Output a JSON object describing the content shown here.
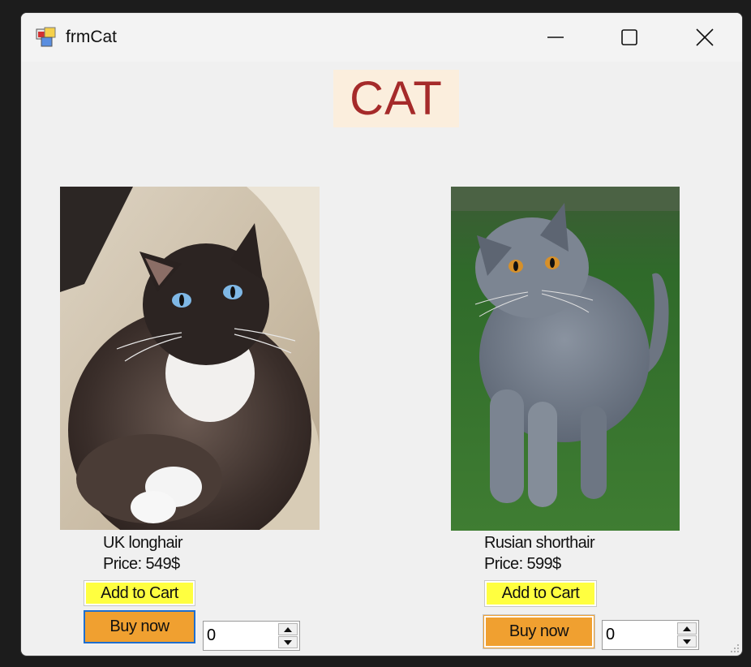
{
  "window": {
    "title": "frmCat"
  },
  "header": {
    "title": "CAT"
  },
  "products": [
    {
      "name": "UK longhair",
      "price": "Price: 549$",
      "add_label": "Add to Cart",
      "buy_label": "Buy now",
      "quantity": "0"
    },
    {
      "name": "Rusian shorthair",
      "price": "Price: 599$",
      "add_label": "Add to Cart",
      "buy_label": "Buy now",
      "quantity": "0"
    }
  ],
  "colors": {
    "title_text": "#a52a2a",
    "title_bg": "#fbeedd",
    "add_button": "#ffff40",
    "buy_button": "#f0a030"
  }
}
